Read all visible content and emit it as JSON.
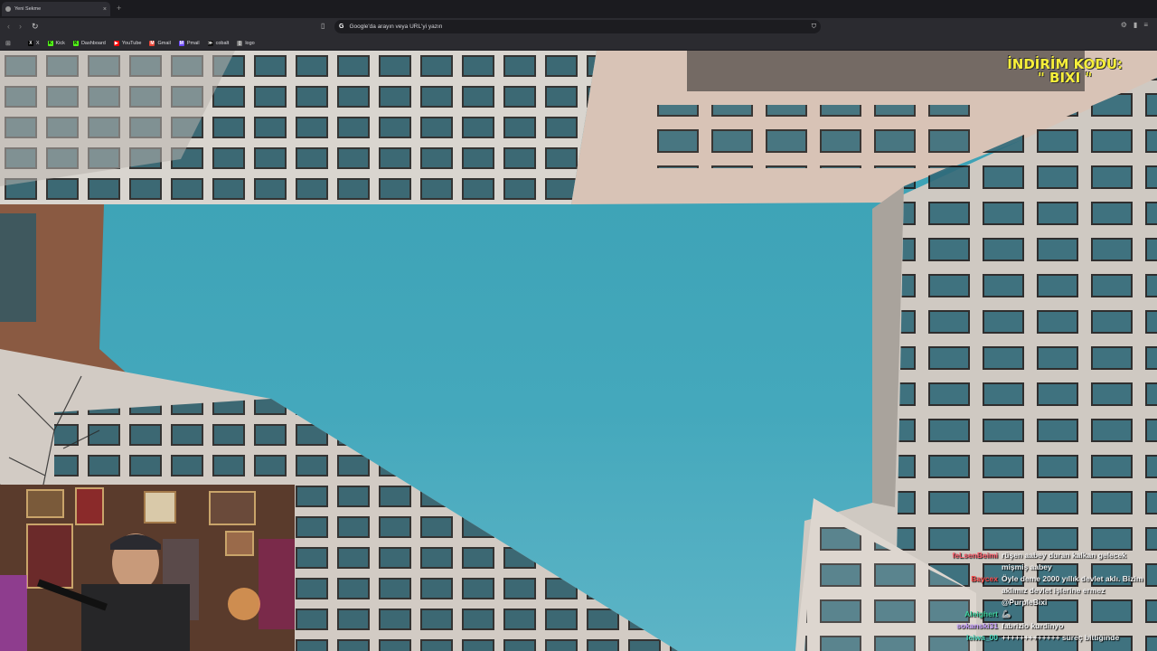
{
  "tab": {
    "title": "Yeni Sekme",
    "close": "×",
    "new": "+"
  },
  "url": {
    "text": "Google'da arayın veya URL'yi yazın"
  },
  "bookmarks": [
    {
      "label": "X",
      "icon": "x-icon",
      "color": "#000000"
    },
    {
      "label": "Kick",
      "icon": "kick-icon",
      "color": "#53fc18"
    },
    {
      "label": "Dashboard",
      "icon": "kick-icon",
      "color": "#53fc18"
    },
    {
      "label": "YouTube",
      "icon": "youtube-icon",
      "color": "#ff0000"
    },
    {
      "label": "Gmail",
      "icon": "gmail-icon",
      "color": "#ea4335"
    },
    {
      "label": "Pmail",
      "icon": "pmail-icon",
      "color": "#6d4aff"
    },
    {
      "label": "cobalt",
      "icon": "cobalt-icon",
      "color": "#111111"
    },
    {
      "label": "logo",
      "icon": "file-icon",
      "color": "#777777"
    }
  ],
  "promo": {
    "line1": "İNDİRİM KODU:",
    "line2": "\" BIXI \""
  },
  "chat": [
    {
      "user": "feLsenBeimi",
      "color": "#ff5d6c",
      "text": "rüşen aabey duran kalkan gelecek mişmiş aabey"
    },
    {
      "user": "Baycex",
      "color": "#ff4a4a",
      "text": "Öyle deme 2000 yıllık devlet aklı. Bizim aklımız devlet işlerine ermez @PurpleBixi"
    },
    {
      "user": "Aleighert",
      "color": "#3fd3a0",
      "text": "🦾"
    },
    {
      "user": "sokanski31",
      "color": "#c7a0ff",
      "text": "fabrizio kurdinyo"
    },
    {
      "user": "leiwa_00",
      "color": "#4fe0c4",
      "text": "+++++++++++++ süreç bittiğinde"
    }
  ]
}
